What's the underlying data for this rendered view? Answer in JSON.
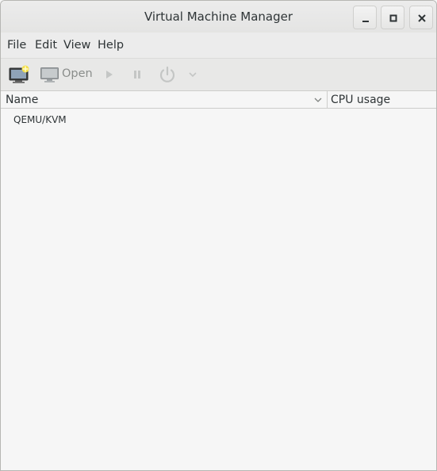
{
  "window": {
    "title": "Virtual Machine Manager"
  },
  "menubar": {
    "items": [
      {
        "label": "File"
      },
      {
        "label": "Edit"
      },
      {
        "label": "View"
      },
      {
        "label": "Help"
      }
    ]
  },
  "toolbar": {
    "new_vm_icon": "new-vm-icon",
    "open_label": "Open",
    "run_icon": "play-icon",
    "pause_icon": "pause-icon",
    "shutdown_icon": "power-icon",
    "shutdown_menu_icon": "chevron-down-icon"
  },
  "list": {
    "columns": [
      {
        "label": "Name"
      },
      {
        "label": "CPU usage"
      }
    ],
    "rows": [
      {
        "name": "QEMU/KVM"
      }
    ]
  },
  "colors": {
    "titlebar": "#e8e8e7",
    "background": "#f6f6f6",
    "disabled_text": "#8a8d8b"
  }
}
